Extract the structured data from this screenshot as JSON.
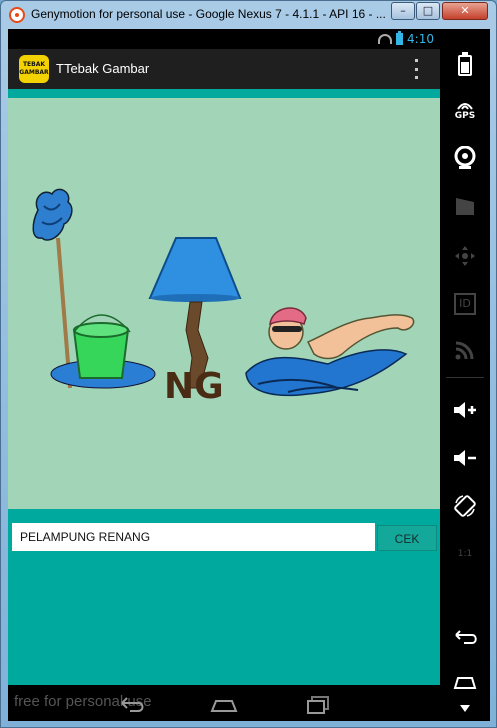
{
  "window": {
    "title": "Genymotion for personal use - Google Nexus 7 - 4.1.1 - API 16 - ...",
    "minimize": "–",
    "maximize": "□",
    "close": "✕"
  },
  "status": {
    "time": "4:10"
  },
  "app": {
    "logo_line1": "TEBAK",
    "logo_line2": "GAMBAR",
    "title": "TTebak Gambar"
  },
  "puzzle": {
    "lamp_text": "NG"
  },
  "answer": {
    "value": "PELAMPUNG RENANG",
    "button": "CEK"
  },
  "watermark": "free for personal use",
  "side_controls": [
    {
      "name": "battery-icon"
    },
    {
      "name": "gps-icon",
      "label": "GPS"
    },
    {
      "name": "webcam-icon"
    },
    {
      "name": "video-icon"
    },
    {
      "name": "dpad-icon"
    },
    {
      "name": "id-icon",
      "label": "ID"
    },
    {
      "name": "broadcast-icon"
    },
    {
      "name": "volume-up-icon"
    },
    {
      "name": "volume-down-icon"
    },
    {
      "name": "rotate-icon"
    },
    {
      "name": "scale-icon",
      "label": "1:1"
    },
    {
      "name": "back-icon"
    },
    {
      "name": "home-icon"
    }
  ],
  "colors": {
    "content_bg": "#00a99d",
    "image_bg": "#a2d5b7",
    "logo_bg": "#f2d200",
    "status_accent": "#33b5e5"
  }
}
